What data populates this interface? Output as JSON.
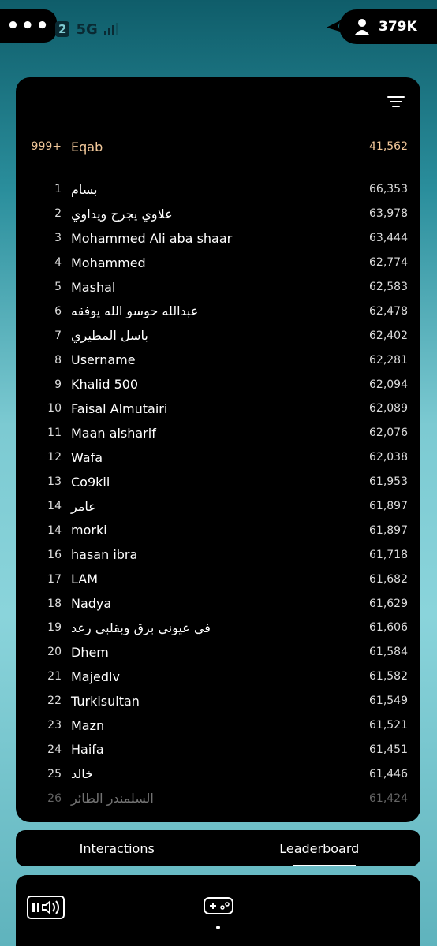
{
  "status_bar": {
    "menu_dots": "•••",
    "sim": "2",
    "network": "5G",
    "coins": "379K"
  },
  "leaderboard": {
    "me": {
      "rank": "999+",
      "name": "Eqab",
      "score": "41,562"
    },
    "entries": [
      {
        "rank": "1",
        "name": "بسام",
        "score": "66,353"
      },
      {
        "rank": "2",
        "name": "علاوي يجرح ويداوي",
        "score": "63,978"
      },
      {
        "rank": "3",
        "name": "Mohammed Ali aba shaar",
        "score": "63,444"
      },
      {
        "rank": "4",
        "name": "Mohammed",
        "score": "62,774"
      },
      {
        "rank": "5",
        "name": "Mashal",
        "score": "62,583"
      },
      {
        "rank": "6",
        "name": "عبدالله حوسو الله يوفقه",
        "score": "62,478"
      },
      {
        "rank": "7",
        "name": "باسل المطيري",
        "score": "62,402"
      },
      {
        "rank": "8",
        "name": "Username",
        "score": "62,281"
      },
      {
        "rank": "9",
        "name": "Khalid 500",
        "score": "62,094"
      },
      {
        "rank": "10",
        "name": "Faisal Almutairi",
        "score": "62,089"
      },
      {
        "rank": "11",
        "name": "Maan alsharif",
        "score": "62,076"
      },
      {
        "rank": "12",
        "name": "Wafa",
        "score": "62,038"
      },
      {
        "rank": "13",
        "name": "Co9kii",
        "score": "61,953"
      },
      {
        "rank": "14",
        "name": "عامر",
        "score": "61,897"
      },
      {
        "rank": "14",
        "name": "morki",
        "score": "61,897"
      },
      {
        "rank": "16",
        "name": "hasan ibra",
        "score": "61,718"
      },
      {
        "rank": "17",
        "name": "LAM",
        "score": "61,682"
      },
      {
        "rank": "18",
        "name": "Nadya",
        "score": "61,629"
      },
      {
        "rank": "19",
        "name": "في عيوني برق وبقلبي رعد",
        "score": "61,606"
      },
      {
        "rank": "20",
        "name": "Dhem",
        "score": "61,584"
      },
      {
        "rank": "21",
        "name": "Majedlv",
        "score": "61,582"
      },
      {
        "rank": "22",
        "name": "Turkisultan",
        "score": "61,549"
      },
      {
        "rank": "23",
        "name": "Mazn",
        "score": "61,521"
      },
      {
        "rank": "24",
        "name": "Haifa",
        "score": "61,451"
      },
      {
        "rank": "25",
        "name": "خالد",
        "score": "61,446"
      },
      {
        "rank": "26",
        "name": "السلمندر الطائر",
        "score": "61,424"
      }
    ]
  },
  "tabs": [
    {
      "label": "Interactions",
      "active": false
    },
    {
      "label": "Leaderboard",
      "active": true
    }
  ],
  "icons": {
    "menu": "more-icon",
    "plane": "airplane-icon",
    "user": "user-icon",
    "filter": "filter-icon",
    "audio": "audio-toggle-icon",
    "gamepad": "gamepad-icon"
  }
}
